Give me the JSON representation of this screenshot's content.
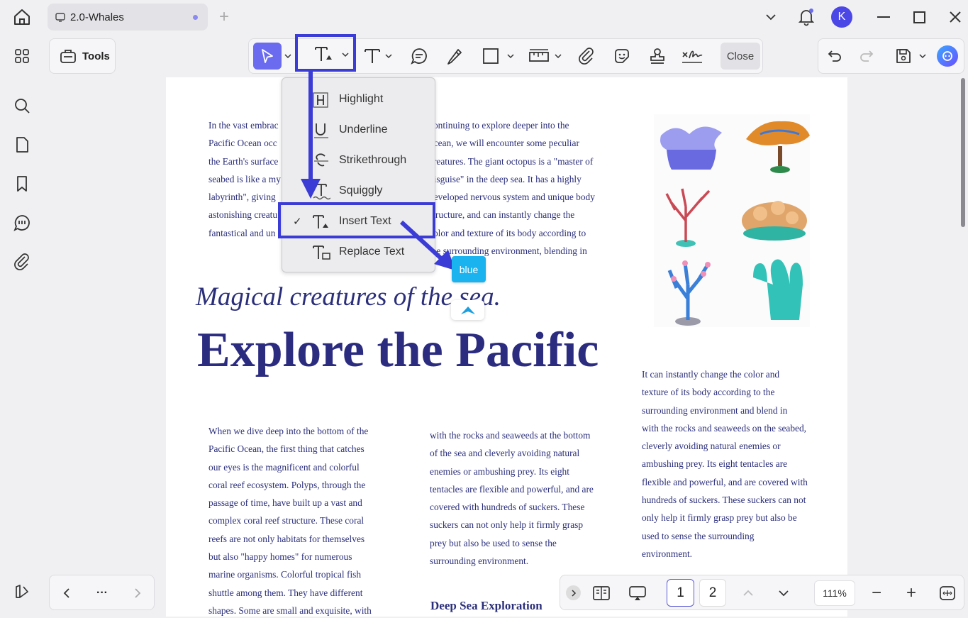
{
  "window": {
    "tab_title": "2.0-Whales",
    "new_tab": "+",
    "user_initial": "K"
  },
  "toolbar": {
    "tools_label": "Tools",
    "close_label": "Close"
  },
  "text_menu": {
    "items": [
      {
        "label": "Highlight",
        "icon": "highlight-icon",
        "checked": false
      },
      {
        "label": "Underline",
        "icon": "underline-icon",
        "checked": false
      },
      {
        "label": "Strikethrough",
        "icon": "strikethrough-icon",
        "checked": false
      },
      {
        "label": "Squiggly",
        "icon": "squiggly-icon",
        "checked": false
      },
      {
        "label": "Insert Text",
        "icon": "insert-text-icon",
        "checked": true
      },
      {
        "label": "Replace Text",
        "icon": "replace-text-icon",
        "checked": false
      }
    ],
    "checkmark": "✓"
  },
  "tooltip": {
    "text": "blue"
  },
  "document": {
    "col1_top": [
      "In the vast embrac",
      "Pacific Ocean occ",
      "the Earth's surface",
      "seabed is like a my",
      "labyrinth\", giving",
      "astonishing creatu",
      "fantastical and un"
    ],
    "col2_top": [
      "continuing to explore deeper into the",
      "ocean, we will encounter some peculiar",
      "creatures. The giant octopus is a \"master of",
      "disguise\" in the deep sea. It has a highly",
      "developed nervous system and unique body",
      "structure, and can instantly change the",
      "color and texture of its body according to",
      "the surrounding environment, blending in"
    ],
    "subtitle": "Magical creatures of the sea.",
    "headline": "Explore the Pacific",
    "col1_bottom": [
      "When we dive deep into the bottom of the",
      "Pacific Ocean, the first thing that catches",
      "our eyes is the magnificent and colorful",
      "coral reef ecosystem. Polyps, through the",
      "passage of time, have built up a vast and",
      "complex coral reef structure. These coral",
      "reefs are not only habitats for themselves",
      "but also \"happy homes\" for numerous",
      "marine organisms. Colorful tropical fish",
      "shuttle among them. They have different",
      "shapes. Some are small and exquisite, with"
    ],
    "col2_bottom": [
      "with the rocks and seaweeds at the bottom",
      "of the sea and cleverly avoiding natural",
      "enemies or ambushing prey. Its eight",
      "tentacles are flexible and powerful, and are",
      "covered with hundreds of suckers. These",
      "suckers can not only help it firmly grasp",
      "prey but also be used to sense the",
      "surrounding environment."
    ],
    "col3": [
      "It can instantly change the color and",
      "texture of its body according to the",
      "surrounding environment and blend in",
      "with the rocks and seaweeds on the seabed,",
      "cleverly avoiding natural enemies or",
      "ambushing prey. Its eight tentacles are",
      "flexible and powerful, and are covered with",
      "hundreds of suckers. These suckers can not",
      "only help it firmly grasp prey but also be",
      "used to sense the surrounding",
      "environment."
    ],
    "section_heading": "Deep Sea Exploration"
  },
  "bottom_nav": {
    "more": "···",
    "pages": [
      "1",
      "2"
    ],
    "current_page": "1",
    "zoom": "111%",
    "zoom_out": "−",
    "zoom_in": "+"
  },
  "colors": {
    "accent": "#3b3bd6",
    "doc_text": "#2b2f7a",
    "tooltip": "#1ab3ef",
    "select_button": "#6b6bf0"
  }
}
